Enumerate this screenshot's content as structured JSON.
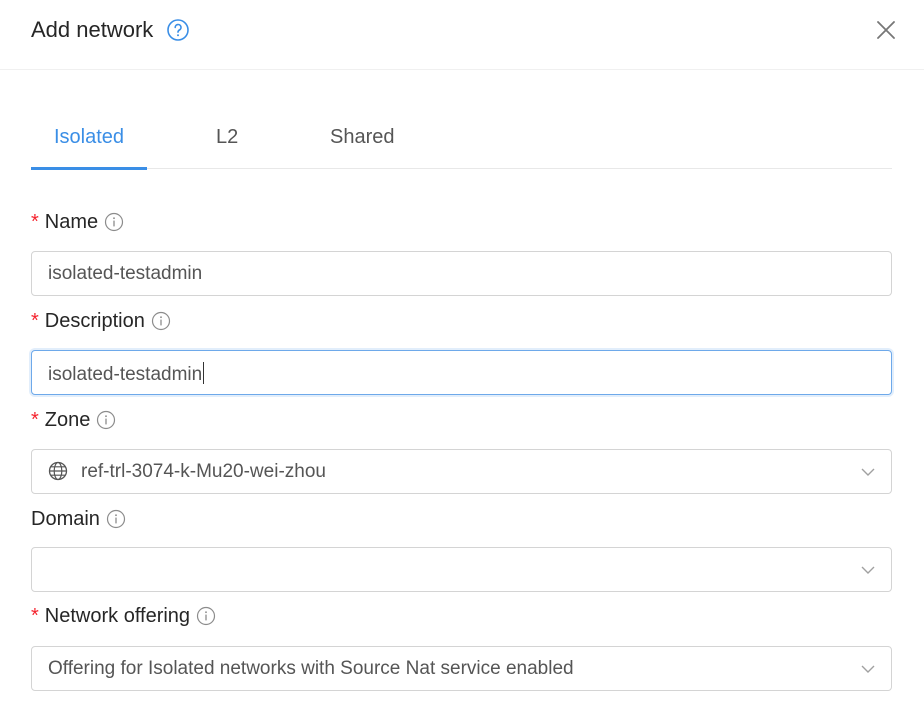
{
  "dialog": {
    "title": "Add network"
  },
  "tabs": [
    {
      "label": "Isolated",
      "active": true
    },
    {
      "label": "L2",
      "active": false
    },
    {
      "label": "Shared",
      "active": false
    }
  ],
  "form": {
    "name": {
      "label": "Name",
      "required": true,
      "value": "isolated-testadmin"
    },
    "description": {
      "label": "Description",
      "required": true,
      "value": "isolated-testadmin"
    },
    "zone": {
      "label": "Zone",
      "required": true,
      "value": "ref-trl-3074-k-Mu20-wei-zhou",
      "icon": "globe-icon"
    },
    "domain": {
      "label": "Domain",
      "required": false,
      "value": ""
    },
    "network_offering": {
      "label": "Network offering",
      "required": true,
      "value": "Offering for Isolated networks with Source Nat service enabled"
    }
  },
  "colors": {
    "accent": "#3a8ee6",
    "required": "#f5222d"
  }
}
